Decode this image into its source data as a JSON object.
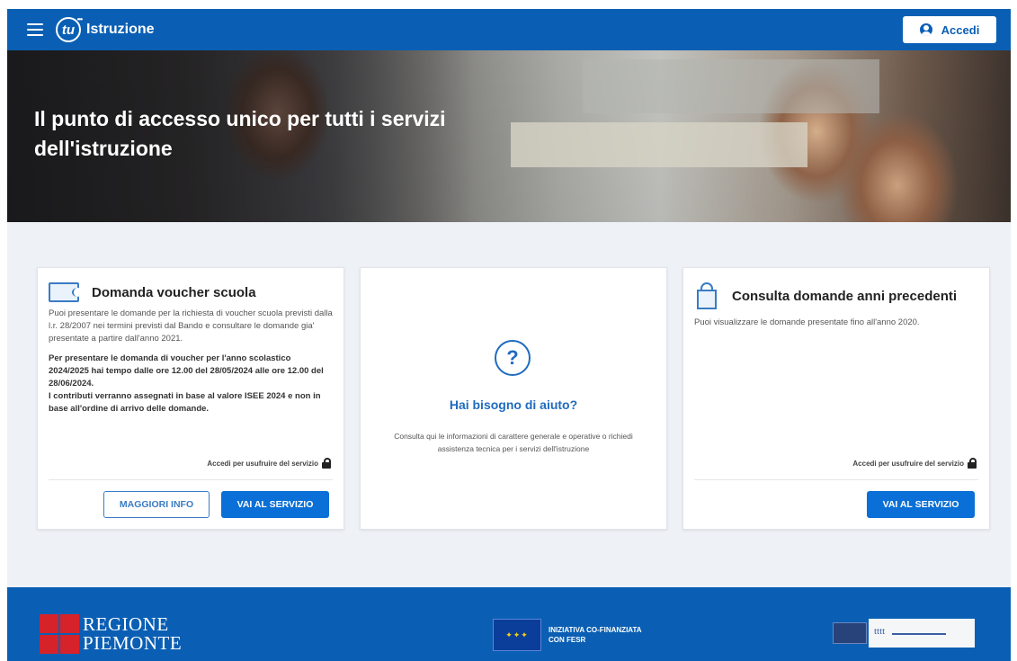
{
  "header": {
    "logo_mark": "tu",
    "logo_text": "Istruzione",
    "login_label": "Accedi"
  },
  "hero": {
    "title": "Il punto di accesso unico per tutti i servizi dell'istruzione"
  },
  "cards": {
    "voucher": {
      "title": "Domanda voucher scuola",
      "intro": "Puoi presentare le domande per la richiesta di voucher scuola previsti dalla l.r. 28/2007 nei termini previsti dal Bando e consultare le domande gia' presentate a partire dall'anno 2021.",
      "deadline": "Per presentare le domanda di voucher per l'anno scolastico 2024/2025 hai tempo dalle ore 12.00 del 28/05/2024 alle ore 12.00 del 28/06/2024.",
      "criteria": "I contributi verranno assegnati in base al valore ISEE 2024 e non in base all'ordine di arrivo delle domande.",
      "access_note": "Accedi per usufruire del servizio",
      "more_info_label": "MAGGIORI INFO",
      "go_label": "VAI AL SERVIZIO"
    },
    "help": {
      "icon_glyph": "?",
      "title": "Hai bisogno di aiuto?",
      "text": "Consulta qui le informazioni di carattere generale e operative o richiedi assistenza tecnica per i servizi dell'istruzione"
    },
    "previous": {
      "title": "Consulta domande anni precedenti",
      "text": "Puoi visualizzare le domande presentate fino all'anno 2020.",
      "access_note": "Accedi per usufruire del servizio",
      "go_label": "VAI AL SERVIZIO"
    }
  },
  "footer": {
    "regione_line1": "REGIONE",
    "regione_line2": "PIEMONTE",
    "eu_line1": "INIZIATIVA CO-FINANZIATA",
    "eu_line2": "CON FESR",
    "partner_text": "tttt"
  },
  "colors": {
    "brand_blue": "#0a5fb4",
    "button_blue": "#0a6fd6",
    "page_bg": "#eef1f6",
    "regione_red": "#d6222a"
  },
  "icons": {
    "menu": "hamburger-icon",
    "user": "user-icon",
    "voucher": "ticket-icon",
    "help": "question-icon",
    "previous": "building-icon",
    "lock": "lock-icon"
  }
}
